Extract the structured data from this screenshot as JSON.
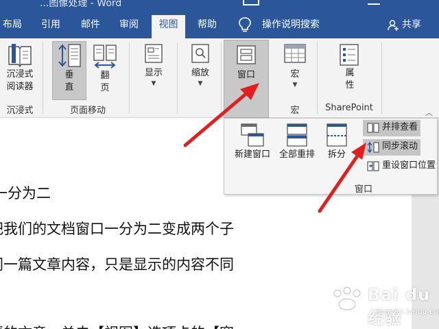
{
  "titlebar": {
    "title_fragment": "...图像处理 - Word",
    "box_icon": "ribbon-display-options-icon",
    "min_icon": "minimize-icon"
  },
  "tabs": [
    {
      "label": "布局",
      "active": false
    },
    {
      "label": "引用",
      "active": false
    },
    {
      "label": "邮件",
      "active": false
    },
    {
      "label": "审阅",
      "active": false
    },
    {
      "label": "视图",
      "active": true
    },
    {
      "label": "帮助",
      "active": false
    }
  ],
  "tell_me": {
    "icon": "lightbulb-icon",
    "label": "操作说明搜索"
  },
  "share": {
    "icon": "person-add-icon",
    "label": "共享"
  },
  "ribbon": {
    "immersive_reader": {
      "label_line1": "沉浸式",
      "label_line2": "阅读器",
      "group": "沉浸式"
    },
    "vertical": {
      "label_line1": "垂",
      "label_line2": "直"
    },
    "side_to_side": {
      "label_line1": "翻",
      "label_line2": "页"
    },
    "page_movement_group": "页面移动",
    "show": {
      "label": "显示"
    },
    "zoom": {
      "label": "缩放"
    },
    "window": {
      "label": "窗口"
    },
    "macros": {
      "label": "宏",
      "group": "宏"
    },
    "properties": {
      "label_line1": "属",
      "label_line2": "性",
      "group": "SharePoint"
    }
  },
  "window_dropdown": {
    "new_window": "新建窗口",
    "arrange_all": "全部重排",
    "split": "拆分",
    "view_side_by_side": "并排查看",
    "sync_scrolling": "同步滚动",
    "reset_window_position": "重设窗口位置",
    "group_label": "窗口"
  },
  "document": {
    "lines": [
      "一分为二",
      "把我们的文档窗口一分为二变成两个子",
      "同一篇文章内容，只是显示的内容不同",
      "要的文章，单击【视图】选项卡的【窗"
    ]
  },
  "watermark": {
    "brand": "Bai du 经验",
    "url": "jingyan.baidu.com"
  },
  "colors": {
    "accent": "#2b579a",
    "arrow": "#e02020",
    "ribbon_bg": "#f3f3f3"
  }
}
